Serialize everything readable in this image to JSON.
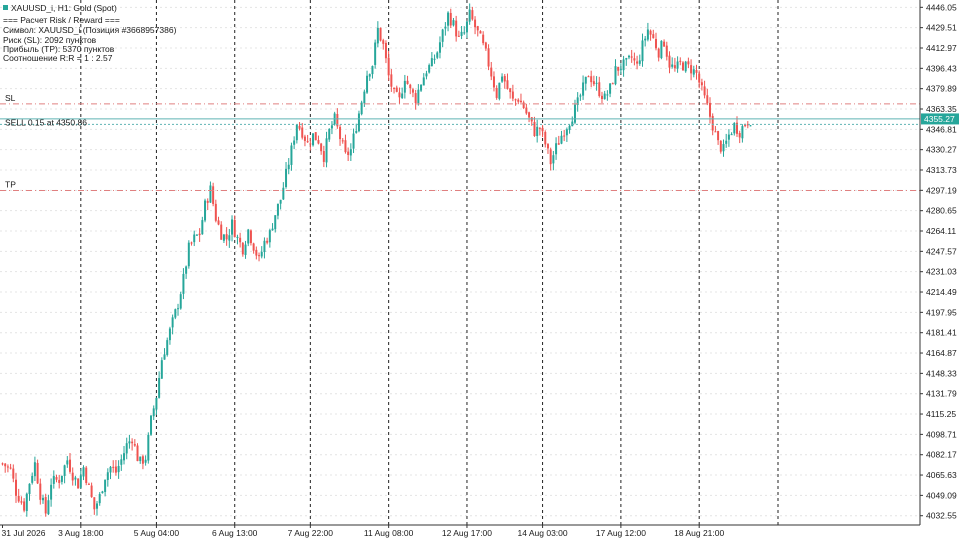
{
  "header": {
    "symbol_title": "XAUUSD_i, H1:  Gold (Spot)",
    "info_lines": [
      "=== Расчет Risk / Reward ===",
      "Символ: XAUUSD_i (Позиция #3668957386)",
      "Риск (SL): 2092 пунктов",
      "Прибыль (TP): 5370 пунктов",
      "Соотношение R:R = 1 : 2.57"
    ]
  },
  "colors": {
    "bull": "#26a69a",
    "bear": "#ef5350",
    "sl_line": "#e08080",
    "tp_line": "#e08080",
    "entry_line": "#5fb3b3",
    "price_tag_bg": "#26a69a",
    "grid": "#e4e4e4",
    "separator": "#222222"
  },
  "chart_data": {
    "type": "candlestick",
    "symbol": "XAUUSD_i",
    "timeframe": "H1",
    "ylim": [
      4025.0,
      4452.0
    ],
    "y_ticks": [
      "4446.05",
      "4429.51",
      "4412.97",
      "4396.43",
      "4379.89",
      "4363.35",
      "4346.81",
      "4330.27",
      "4313.73",
      "4297.19",
      "4280.65",
      "4264.11",
      "4247.57",
      "4231.03",
      "4214.49",
      "4197.95",
      "4181.41",
      "4164.87",
      "4148.33",
      "4131.79",
      "4115.25",
      "4098.71",
      "4082.17",
      "4065.63",
      "4049.09",
      "4032.55"
    ],
    "x_ticks": [
      "31 Jul 2026",
      "3 Aug 18:00",
      "5 Aug 04:00",
      "6 Aug 13:00",
      "7 Aug 22:00",
      "11 Aug 08:00",
      "12 Aug 17:00",
      "14 Aug 03:00",
      "17 Aug 12:00",
      "18 Aug 21:00"
    ],
    "price_levels": {
      "sl": {
        "label": "SL",
        "price": 4367.5
      },
      "entry": {
        "label": "SELL 0.15 at 4350.86",
        "price": 4350.86
      },
      "tp": {
        "label": "TP",
        "price": 4297.1
      },
      "current": {
        "label": "4355.27",
        "price": 4355.27
      }
    },
    "path_points": [
      [
        0,
        4075
      ],
      [
        3,
        4070
      ],
      [
        5,
        4052
      ],
      [
        8,
        4040
      ],
      [
        10,
        4060
      ],
      [
        12,
        4075
      ],
      [
        14,
        4050
      ],
      [
        16,
        4035
      ],
      [
        18,
        4060
      ],
      [
        21,
        4062
      ],
      [
        24,
        4078
      ],
      [
        26,
        4066
      ],
      [
        28,
        4058
      ],
      [
        30,
        4072
      ],
      [
        32,
        4055
      ],
      [
        34,
        4038
      ],
      [
        36,
        4048
      ],
      [
        38,
        4065
      ],
      [
        40,
        4072
      ],
      [
        42,
        4068
      ],
      [
        44,
        4078
      ],
      [
        46,
        4090
      ],
      [
        48,
        4096
      ],
      [
        50,
        4080
      ],
      [
        51,
        4076
      ],
      [
        53,
        4080
      ],
      [
        55,
        4110
      ],
      [
        57,
        4130
      ],
      [
        59,
        4160
      ],
      [
        61,
        4175
      ],
      [
        63,
        4190
      ],
      [
        65,
        4205
      ],
      [
        67,
        4225
      ],
      [
        69,
        4250
      ],
      [
        71,
        4258
      ],
      [
        73,
        4262
      ],
      [
        75,
        4285
      ],
      [
        77,
        4298
      ],
      [
        79,
        4275
      ],
      [
        81,
        4262
      ],
      [
        83,
        4258
      ],
      [
        85,
        4270
      ],
      [
        87,
        4258
      ],
      [
        89,
        4250
      ],
      [
        91,
        4265
      ],
      [
        93,
        4252
      ],
      [
        95,
        4240
      ],
      [
        97,
        4255
      ],
      [
        99,
        4262
      ],
      [
        101,
        4278
      ],
      [
        103,
        4290
      ],
      [
        105,
        4310
      ],
      [
        107,
        4330
      ],
      [
        109,
        4352
      ],
      [
        111,
        4345
      ],
      [
        113,
        4335
      ],
      [
        115,
        4342
      ],
      [
        117,
        4338
      ],
      [
        119,
        4325
      ],
      [
        121,
        4345
      ],
      [
        123,
        4355
      ],
      [
        125,
        4340
      ],
      [
        127,
        4325
      ],
      [
        129,
        4330
      ],
      [
        131,
        4350
      ],
      [
        133,
        4370
      ],
      [
        135,
        4392
      ],
      [
        137,
        4400
      ],
      [
        139,
        4428
      ],
      [
        141,
        4415
      ],
      [
        143,
        4390
      ],
      [
        145,
        4375
      ],
      [
        147,
        4370
      ],
      [
        149,
        4390
      ],
      [
        151,
        4378
      ],
      [
        153,
        4372
      ],
      [
        155,
        4385
      ],
      [
        157,
        4395
      ],
      [
        159,
        4400
      ],
      [
        161,
        4410
      ],
      [
        163,
        4425
      ],
      [
        165,
        4440
      ],
      [
        167,
        4432
      ],
      [
        169,
        4420
      ],
      [
        171,
        4425
      ],
      [
        173,
        4440
      ],
      [
        175,
        4430
      ],
      [
        177,
        4420
      ],
      [
        179,
        4408
      ],
      [
        181,
        4392
      ],
      [
        183,
        4375
      ],
      [
        185,
        4392
      ],
      [
        187,
        4380
      ],
      [
        189,
        4370
      ],
      [
        191,
        4372
      ],
      [
        193,
        4365
      ],
      [
        195,
        4355
      ],
      [
        197,
        4345
      ],
      [
        199,
        4348
      ],
      [
        201,
        4335
      ],
      [
        203,
        4320
      ],
      [
        205,
        4332
      ],
      [
        207,
        4342
      ],
      [
        209,
        4350
      ],
      [
        211,
        4358
      ],
      [
        213,
        4368
      ],
      [
        215,
        4380
      ],
      [
        217,
        4392
      ],
      [
        219,
        4385
      ],
      [
        221,
        4378
      ],
      [
        223,
        4372
      ],
      [
        225,
        4380
      ],
      [
        227,
        4395
      ],
      [
        229,
        4398
      ],
      [
        231,
        4400
      ],
      [
        233,
        4405
      ],
      [
        235,
        4398
      ],
      [
        237,
        4415
      ],
      [
        239,
        4428
      ],
      [
        241,
        4420
      ],
      [
        243,
        4410
      ],
      [
        245,
        4418
      ],
      [
        247,
        4400
      ],
      [
        249,
        4395
      ],
      [
        251,
        4400
      ],
      [
        253,
        4398
      ],
      [
        255,
        4396
      ],
      [
        257,
        4392
      ],
      [
        259,
        4378
      ],
      [
        261,
        4365
      ],
      [
        263,
        4350
      ],
      [
        265,
        4335
      ],
      [
        267,
        4330
      ],
      [
        269,
        4342
      ],
      [
        271,
        4350
      ],
      [
        273,
        4345
      ],
      [
        275,
        4352
      ],
      [
        277,
        4355
      ]
    ]
  }
}
